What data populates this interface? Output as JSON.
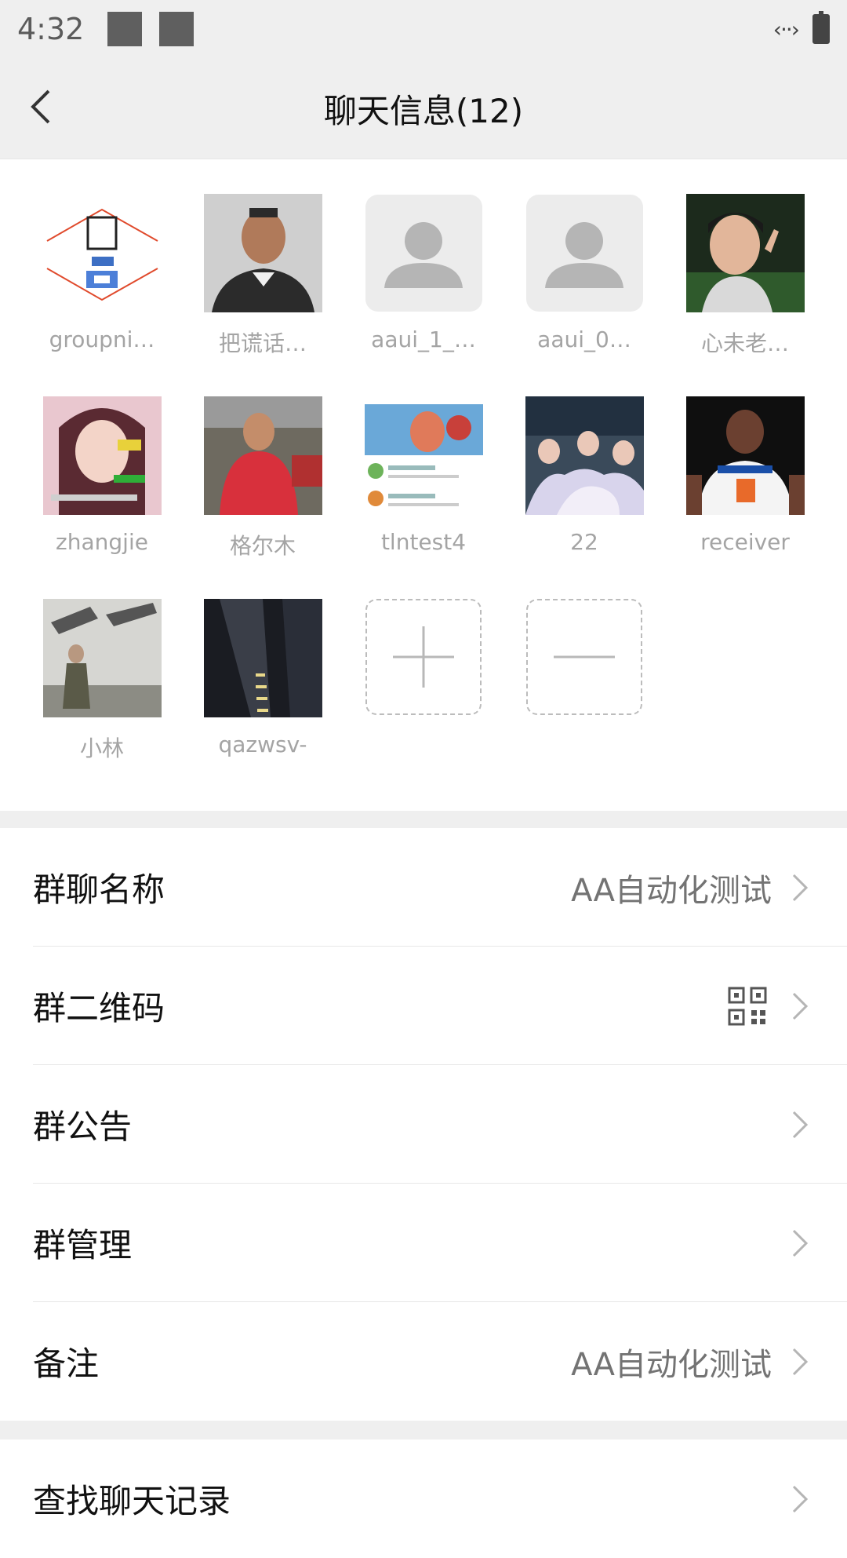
{
  "status_bar": {
    "time": "4:32",
    "data_indicator": "‹··›"
  },
  "header": {
    "title": "聊天信息(12)"
  },
  "members": [
    {
      "name": "groupni…",
      "avatar": "logo"
    },
    {
      "name": "把谎话…",
      "avatar": "man"
    },
    {
      "name": "aaui_1_…",
      "avatar": "placeholder"
    },
    {
      "name": "aaui_0…",
      "avatar": "placeholder"
    },
    {
      "name": "心未老…",
      "avatar": "girl-sport"
    },
    {
      "name": "zhangjie",
      "avatar": "girl-pink"
    },
    {
      "name": "格尔木",
      "avatar": "woman-market"
    },
    {
      "name": "tlntest4",
      "avatar": "screenshot"
    },
    {
      "name": "22",
      "avatar": "group-photo"
    },
    {
      "name": "receiver",
      "avatar": "basketball"
    },
    {
      "name": "小林",
      "avatar": "soldier"
    },
    {
      "name": "qazwsv-",
      "avatar": "building"
    }
  ],
  "settings": {
    "group_name": {
      "label": "群聊名称",
      "value": "AA自动化测试"
    },
    "group_qr": {
      "label": "群二维码"
    },
    "group_notice": {
      "label": "群公告"
    },
    "group_manage": {
      "label": "群管理"
    },
    "remark": {
      "label": "备注",
      "value": "AA自动化测试"
    },
    "search_history": {
      "label": "查找聊天记录"
    }
  }
}
